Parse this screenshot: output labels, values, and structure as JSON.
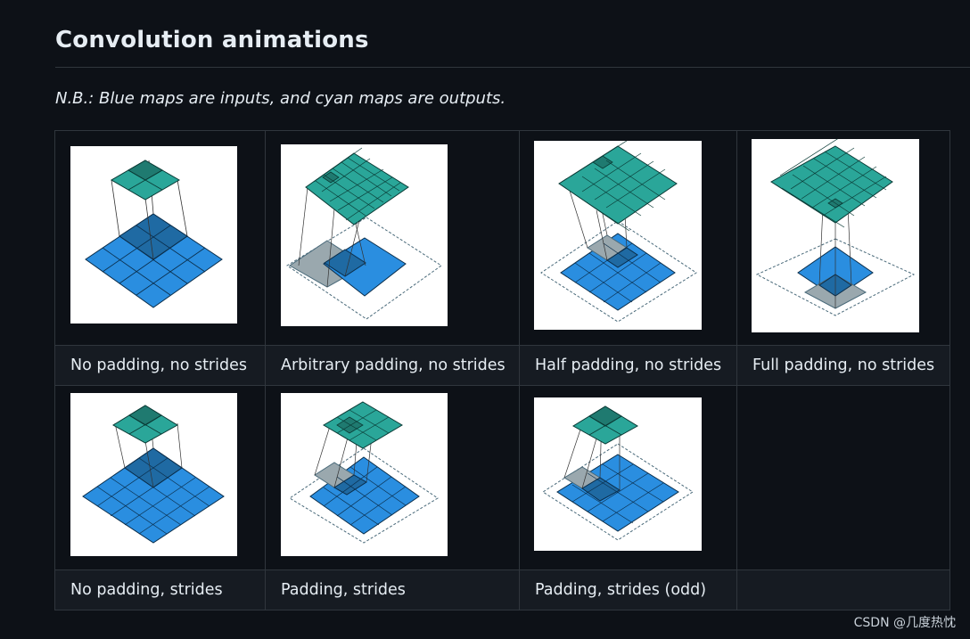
{
  "heading": "Convolution animations",
  "note": "N.B.: Blue maps are inputs, and cyan maps are outputs.",
  "rows": [
    [
      {
        "caption": "No padding, no strides"
      },
      {
        "caption": "Arbitrary padding, no strides"
      },
      {
        "caption": "Half padding, no strides"
      },
      {
        "caption": "Full padding, no strides"
      }
    ],
    [
      {
        "caption": "No padding, strides"
      },
      {
        "caption": "Padding, strides"
      },
      {
        "caption": "Padding, strides (odd)"
      },
      {
        "caption": ""
      }
    ]
  ],
  "watermark": "CSDN @几度热忱",
  "colors": {
    "input_blue": "#2a8ee0",
    "output_cyan": "#2aa699",
    "kernel_shade": "#1f5f8a",
    "padding_gray": "#9aa8ae"
  }
}
